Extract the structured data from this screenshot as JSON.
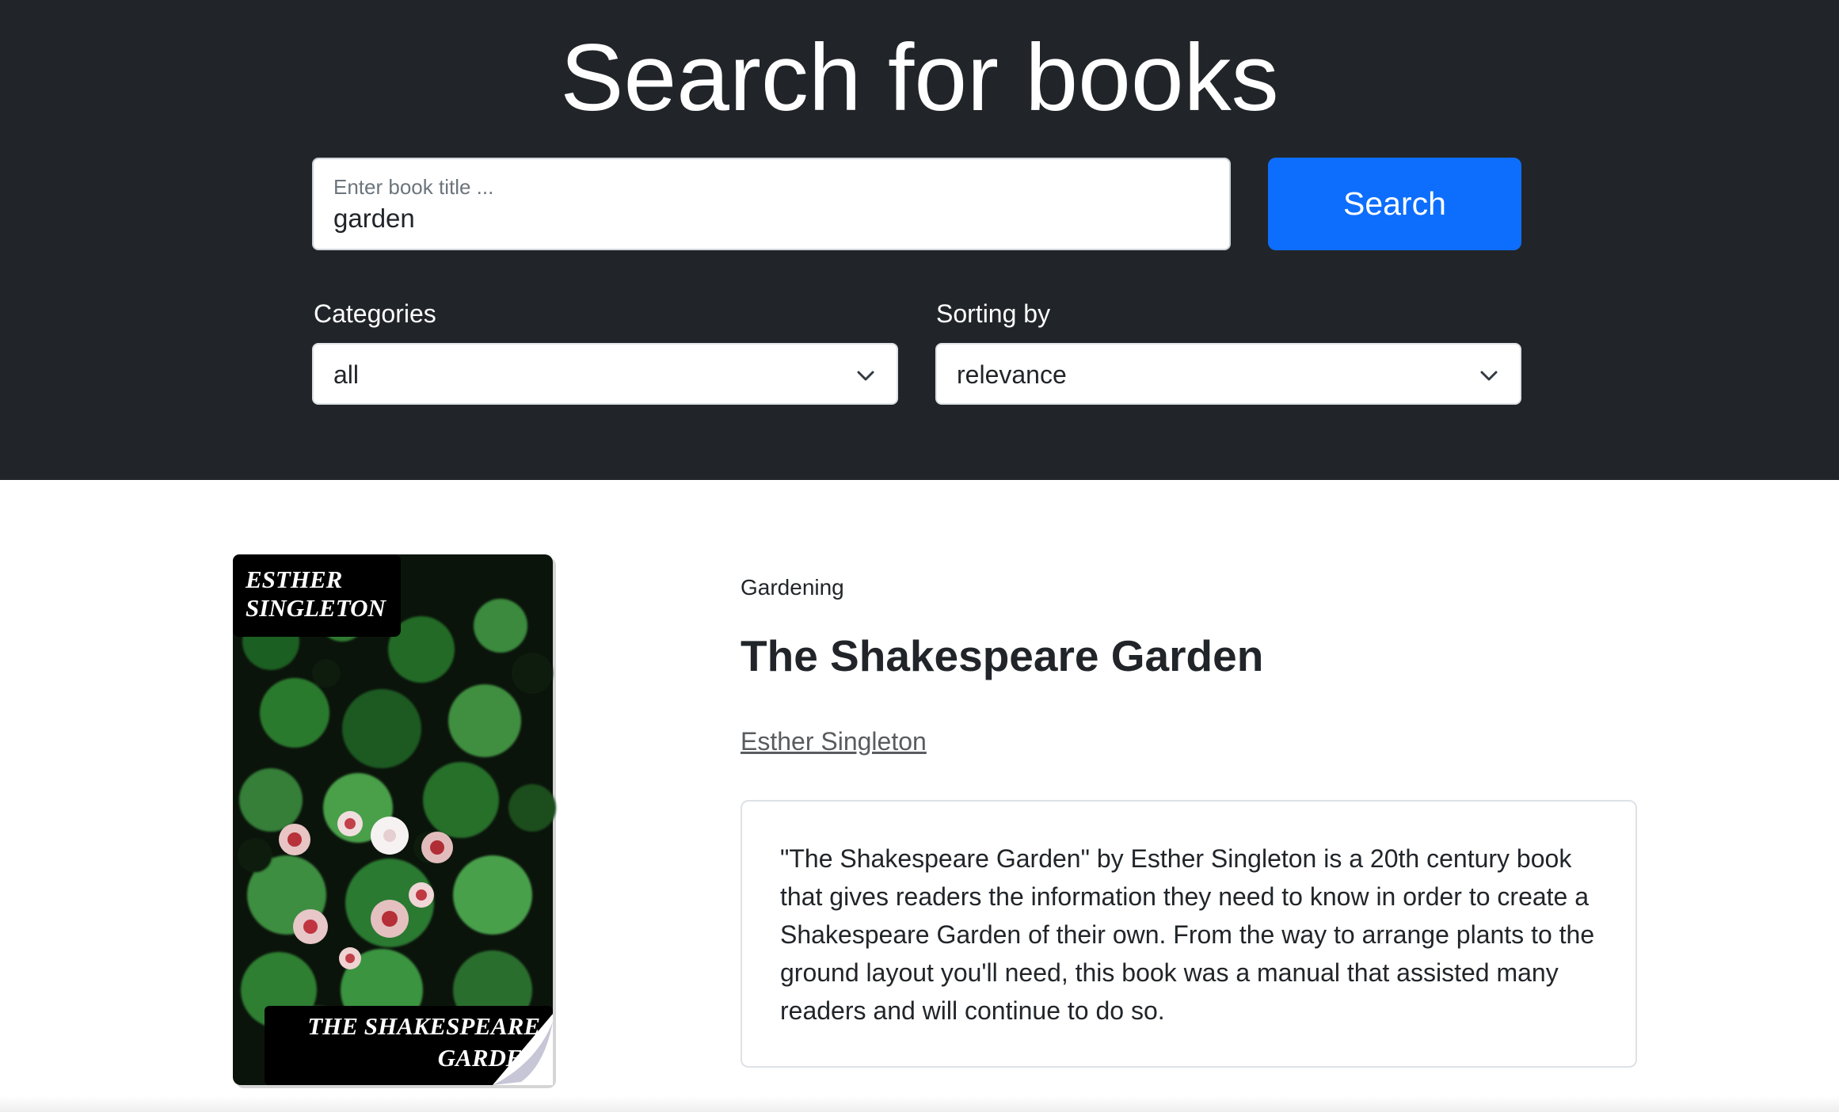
{
  "header": {
    "title": "Search for books"
  },
  "search": {
    "label": "Enter book title ...",
    "value": "garden",
    "button_label": "Search"
  },
  "filters": {
    "categories": {
      "label": "Categories",
      "selected": "all"
    },
    "sorting": {
      "label": "Sorting by",
      "selected": "relevance"
    }
  },
  "book": {
    "cover": {
      "author_text": "ESTHER SINGLETON",
      "title_text": "THE SHAKESPEARE GARDEN"
    },
    "category": "Gardening",
    "title": "The Shakespeare Garden",
    "author": "Esther Singleton",
    "description": "\"The Shakespeare Garden\" by Esther Singleton is a 20th century book that gives readers the information they need to know in order to create a Shakespeare Garden of their own. From the way to arrange plants to the ground layout you'll need, this book was a manual that assisted many readers and will continue to do so."
  },
  "colors": {
    "header_bg": "#212529",
    "primary": "#0d6efd"
  }
}
